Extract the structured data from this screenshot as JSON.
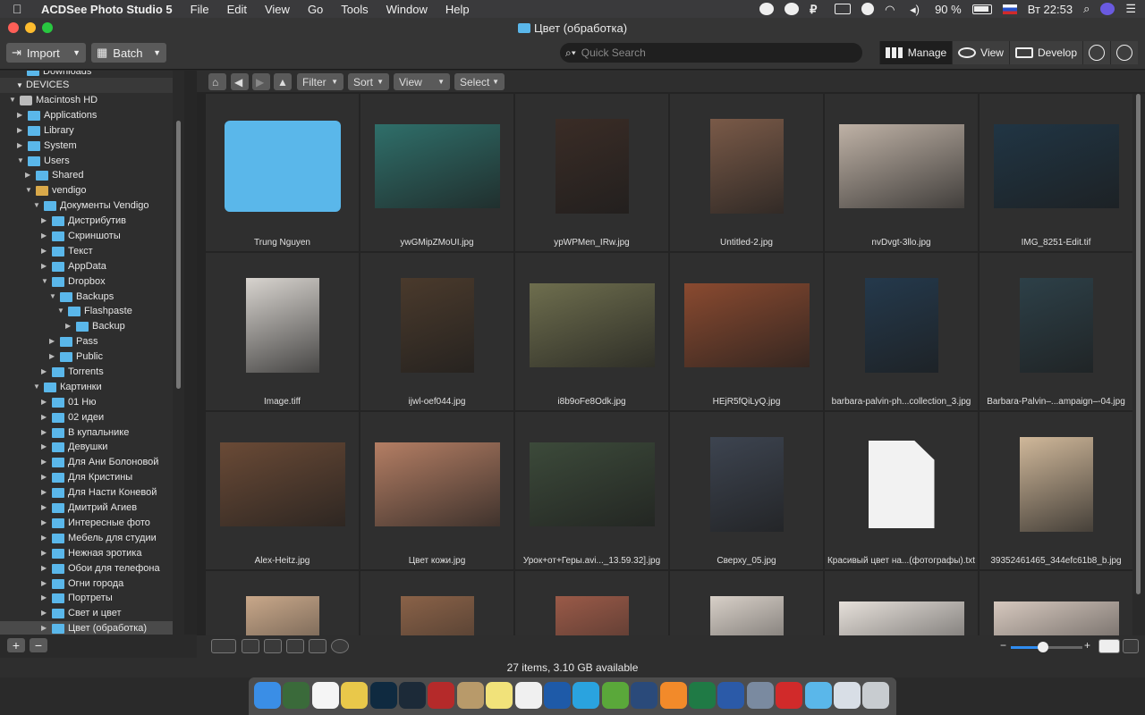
{
  "menubar": {
    "app_name": "ACDSee Photo Studio 5",
    "menus": [
      "File",
      "Edit",
      "View",
      "Go",
      "Tools",
      "Window",
      "Help"
    ],
    "battery": "90 %",
    "clock": "Вт 22:53"
  },
  "window": {
    "title": "Цвет (обработка)"
  },
  "toolbar": {
    "import_label": "Import",
    "batch_label": "Batch",
    "search_placeholder": "Quick Search",
    "modes": [
      "Manage",
      "View",
      "Develop"
    ]
  },
  "sidebar": {
    "section": "DEVICES",
    "partial_top": "Downloads",
    "tree": [
      {
        "label": "Macintosh HD",
        "depth": 1,
        "expanded": true,
        "icon": "drive-icon"
      },
      {
        "label": "Applications",
        "depth": 2,
        "expanded": false
      },
      {
        "label": "Library",
        "depth": 2,
        "expanded": false
      },
      {
        "label": "System",
        "depth": 2,
        "expanded": false
      },
      {
        "label": "Users",
        "depth": 2,
        "expanded": true
      },
      {
        "label": "Shared",
        "depth": 3,
        "expanded": false
      },
      {
        "label": "vendigo",
        "depth": 3,
        "expanded": true,
        "icon": "home-icon"
      },
      {
        "label": "Документы Vendigo",
        "depth": 4,
        "expanded": true
      },
      {
        "label": "Дистрибутив",
        "depth": 5,
        "expanded": false
      },
      {
        "label": "Скриншоты",
        "depth": 5,
        "expanded": false
      },
      {
        "label": "Текст",
        "depth": 5,
        "expanded": false
      },
      {
        "label": "AppData",
        "depth": 5,
        "expanded": false
      },
      {
        "label": "Dropbox",
        "depth": 5,
        "expanded": true
      },
      {
        "label": "Backups",
        "depth": 6,
        "expanded": true
      },
      {
        "label": "Flashpaste",
        "depth": 7,
        "expanded": true
      },
      {
        "label": "Backup",
        "depth": 8,
        "expanded": false
      },
      {
        "label": "Pass",
        "depth": 6,
        "expanded": false
      },
      {
        "label": "Public",
        "depth": 6,
        "expanded": false
      },
      {
        "label": "Torrents",
        "depth": 5,
        "expanded": false
      },
      {
        "label": "Картинки",
        "depth": 4,
        "expanded": true
      },
      {
        "label": "01 Ню",
        "depth": 5,
        "expanded": false
      },
      {
        "label": "02 идеи",
        "depth": 5,
        "expanded": false
      },
      {
        "label": "В купальнике",
        "depth": 5,
        "expanded": false
      },
      {
        "label": "Девушки",
        "depth": 5,
        "expanded": false
      },
      {
        "label": "Для Ани Болоновой",
        "depth": 5,
        "expanded": false
      },
      {
        "label": "Для Кристины",
        "depth": 5,
        "expanded": false
      },
      {
        "label": "Для Насти Коневой",
        "depth": 5,
        "expanded": false
      },
      {
        "label": "Дмитрий Агиев",
        "depth": 5,
        "expanded": false
      },
      {
        "label": "Интересные фото",
        "depth": 5,
        "expanded": false
      },
      {
        "label": "Мебель для студии",
        "depth": 5,
        "expanded": false
      },
      {
        "label": "Нежная эротика",
        "depth": 5,
        "expanded": false
      },
      {
        "label": "Обои для телефона",
        "depth": 5,
        "expanded": false
      },
      {
        "label": "Огни города",
        "depth": 5,
        "expanded": false
      },
      {
        "label": "Портреты",
        "depth": 5,
        "expanded": false
      },
      {
        "label": "Свет и цвет",
        "depth": 5,
        "expanded": false
      },
      {
        "label": "Цвет (обработка)",
        "depth": 5,
        "expanded": false,
        "selected": true
      }
    ]
  },
  "nav": {
    "filter_label": "Filter",
    "sort_label": "Sort",
    "view_label": "View",
    "select_label": "Select"
  },
  "files": [
    {
      "name": "Trung Nguyen",
      "kind": "folder",
      "tone": "#5ab7ea"
    },
    {
      "name": "ywGMipZMoUI.jpg",
      "kind": "landscape",
      "tone": "#2f6f6a"
    },
    {
      "name": "ypWPMen_IRw.jpg",
      "kind": "portrait",
      "tone": "#3a2c26"
    },
    {
      "name": "Untitled-2.jpg",
      "kind": "portrait",
      "tone": "#7a5a48"
    },
    {
      "name": "nvDvgt-3llo.jpg",
      "kind": "landscape",
      "tone": "#bfb2a6"
    },
    {
      "name": "IMG_8251-Edit.tif",
      "kind": "landscape",
      "tone": "#203544"
    },
    {
      "name": "Image.tiff",
      "kind": "portrait",
      "tone": "#d8d4cf"
    },
    {
      "name": "ijwl-oef044.jpg",
      "kind": "portrait",
      "tone": "#4a3a2c"
    },
    {
      "name": "i8b9oFe8Odk.jpg",
      "kind": "landscape",
      "tone": "#6e6e4e"
    },
    {
      "name": "HEjR5fQiLyQ.jpg",
      "kind": "landscape",
      "tone": "#8a4a30"
    },
    {
      "name": "barbara-palvin-ph...collection_3.jpg",
      "kind": "portrait",
      "tone": "#24394c"
    },
    {
      "name": "Barbara-Palvin–...ampaign–-04.jpg",
      "kind": "portrait",
      "tone": "#2d4048"
    },
    {
      "name": "Alex-Heitz.jpg",
      "kind": "landscape",
      "tone": "#6a4a36"
    },
    {
      "name": "Цвет кожи.jpg",
      "kind": "landscape",
      "tone": "#b47e64"
    },
    {
      "name": "Урок+от+Геры.avi..._13.59.32].jpg",
      "kind": "landscape",
      "tone": "#3c4a3a"
    },
    {
      "name": "Сверху_05.jpg",
      "kind": "portrait",
      "tone": "#3d4450"
    },
    {
      "name": "Красивый цвет на...(фотографы).txt",
      "kind": "document",
      "tone": "#f2f2f2"
    },
    {
      "name": "39352461465_344efc61b8_b.jpg",
      "kind": "portrait",
      "tone": "#d0b89a"
    },
    {
      "name": "",
      "kind": "portrait",
      "tone": "#c9a88a"
    },
    {
      "name": "",
      "kind": "portrait",
      "tone": "#8a6248"
    },
    {
      "name": "",
      "kind": "portrait",
      "tone": "#9a5a48"
    },
    {
      "name": "",
      "kind": "portrait",
      "tone": "#d8d0c8"
    },
    {
      "name": "",
      "kind": "landscape",
      "tone": "#e6e0da"
    },
    {
      "name": "",
      "kind": "landscape",
      "tone": "#d6c8be"
    }
  ],
  "statusbar": {
    "text": "27 items, 3.10 GB available"
  },
  "zoom": {
    "level": 0.45
  },
  "dock": {
    "apps": [
      {
        "name": "finder-icon",
        "color": "#3a8ee6"
      },
      {
        "name": "mosaic-icon",
        "color": "#3a6a3a"
      },
      {
        "name": "calendar-icon",
        "color": "#f5f5f5"
      },
      {
        "name": "chrome-icon",
        "color": "#e9c84a"
      },
      {
        "name": "photoshop-icon",
        "color": "#0f2a40"
      },
      {
        "name": "lightroom-icon",
        "color": "#1c2a38"
      },
      {
        "name": "acdsee-icon",
        "color": "#b52a2a"
      },
      {
        "name": "notes-icon",
        "color": "#b89a6a"
      },
      {
        "name": "stickies-icon",
        "color": "#f1e27a"
      },
      {
        "name": "textedit-icon",
        "color": "#f0f0f0"
      },
      {
        "name": "bitwarden-icon",
        "color": "#1e5aa8"
      },
      {
        "name": "telegram-icon",
        "color": "#2aa3df"
      },
      {
        "name": "utorrent-icon",
        "color": "#5aa83a"
      },
      {
        "name": "quicktime-icon",
        "color": "#2a4a7a"
      },
      {
        "name": "books-icon",
        "color": "#f28a2a"
      },
      {
        "name": "excel-icon",
        "color": "#1f7a45"
      },
      {
        "name": "word-icon",
        "color": "#2b5aa8"
      },
      {
        "name": "launchpad-icon",
        "color": "#7a8aa0"
      },
      {
        "name": "opera-icon",
        "color": "#d12a2a"
      },
      {
        "name": "downloads-folder-icon",
        "color": "#5ab7ea"
      },
      {
        "name": "preview-icon",
        "color": "#d8dee6"
      },
      {
        "name": "trash-icon",
        "color": "#c8ccd0"
      }
    ]
  }
}
